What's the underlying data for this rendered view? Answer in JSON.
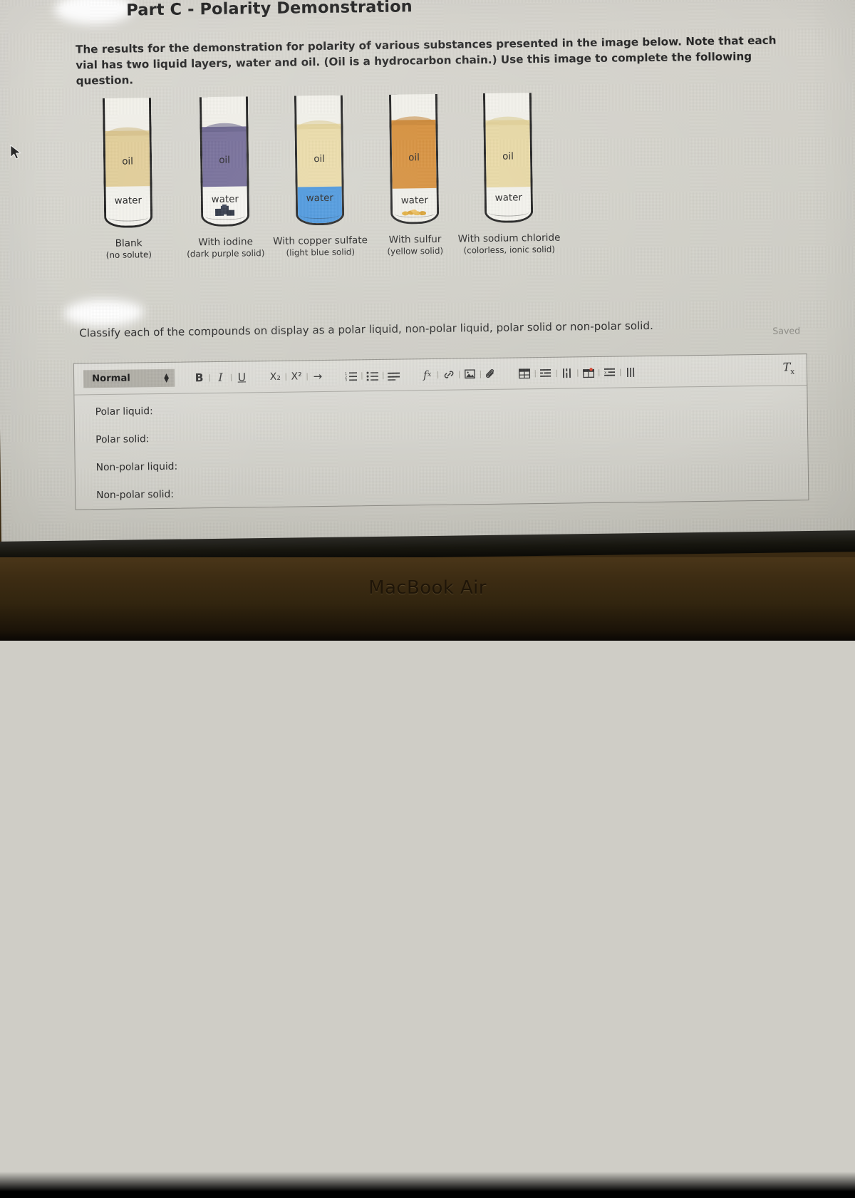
{
  "device": {
    "label": "MacBook Air"
  },
  "page": {
    "title": "Part C - Polarity Demonstration",
    "intro": "The results for the demonstration for polarity of various substances presented in the image below. Note that each vial has two liquid layers, water and oil. (Oil is a hydrocarbon chain.) Use this image to complete the following question.",
    "question": "Classify each of the compounds on display as a polar liquid, non-polar liquid, polar solid or non-polar solid.",
    "saved_status": "Saved"
  },
  "diagram": {
    "oil_label": "oil",
    "water_label": "water",
    "vials": [
      {
        "caption": "Blank",
        "sub_caption": "(no solute)",
        "oil_color": "#e2cc93",
        "water_color": "#f3f2ec",
        "solid": null,
        "solid_color": null
      },
      {
        "caption": "With iodine",
        "sub_caption": "(dark purple solid)",
        "oil_color": "#6b6392",
        "water_color": "#f5f4ef",
        "solid": "bottom-crystals",
        "solid_color": "#1c2436"
      },
      {
        "caption": "With copper sulfate",
        "sub_caption": "(light blue solid)",
        "oil_color": "#ead9a2",
        "water_color": "#3b8edb",
        "solid": null,
        "solid_color": null
      },
      {
        "caption": "With sulfur",
        "sub_caption": "(yellow solid)",
        "oil_color": "#d4862a",
        "water_color": "#f0efe8",
        "solid": "bottom-crystals",
        "solid_color": "#e0a82e"
      },
      {
        "caption": "With sodium chloride",
        "sub_caption": "(colorless, ionic solid)",
        "oil_color": "#e8d79f",
        "water_color": "#f3f2ec",
        "solid": null,
        "solid_color": null
      }
    ]
  },
  "editor": {
    "style_selector": "Normal",
    "toolbar": {
      "bold": "B",
      "italic": "I",
      "underline": "U",
      "subscript": "X₂",
      "superscript": "X²",
      "indent": "→",
      "clear_formatting": "Tx"
    },
    "answer_lines": [
      "Polar liquid:",
      "Polar solid:",
      "Non-polar liquid:",
      "Non-polar solid:"
    ]
  }
}
